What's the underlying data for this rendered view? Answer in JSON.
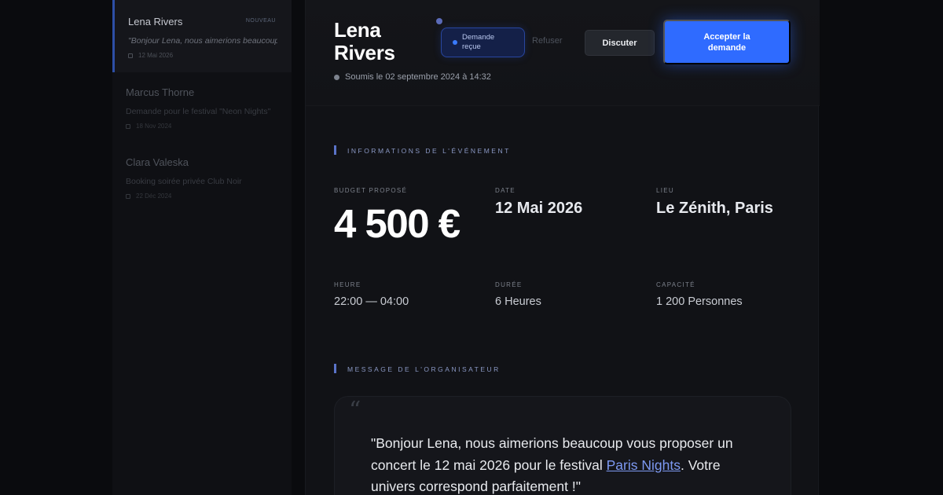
{
  "sidebar": {
    "items": [
      {
        "name": "Lena Rivers",
        "badge": "NOUVEAU",
        "preview": "\"Bonjour Lena, nous aimerions beaucoup vous proposer un concert...",
        "date": "12 Mai 2026"
      },
      {
        "name": "Marcus Thorne",
        "preview": "Demande pour le festival \"Neon Nights\"",
        "date": "18 Nov 2024"
      },
      {
        "name": "Clara Valeska",
        "preview": "Booking soirée privée Club Noir",
        "date": "22 Déc 2024"
      }
    ]
  },
  "header": {
    "artist_name": "Lena Rivers",
    "status_label": "Demande reçue",
    "submitted": "Soumis le 02 septembre 2024 à 14:32",
    "refuse_label": "Refuser",
    "discuss_label": "Discuter",
    "accept_label": "Accepter la demande"
  },
  "event": {
    "section_title": "INFORMATIONS DE L'ÉVÉNEMENT",
    "budget": {
      "label": "BUDGET PROPOSÉ",
      "value": "4 500 €"
    },
    "date": {
      "label": "DATE",
      "value": "12 Mai 2026"
    },
    "lieu": {
      "label": "LIEU",
      "value": "Le Zénith, Paris"
    },
    "heure": {
      "label": "HEURE",
      "value": "22:00 — 04:00"
    },
    "duree": {
      "label": "DURÉE",
      "value": "6 Heures"
    },
    "capacite": {
      "label": "CAPACITÉ",
      "value": "1 200 Personnes"
    }
  },
  "message": {
    "section_title": "MESSAGE DE L'ORGANISATEUR",
    "quote_icon": "“",
    "text_before": "\"Bonjour Lena, nous aimerions beaucoup vous proposer un concert le 12 mai 2026 pour le festival ",
    "link_text": "Paris Nights",
    "text_after": ". Votre univers correspond parfaitement !\""
  },
  "colors": {
    "accent": "#2f6bff",
    "background": "#0a0b0e",
    "panel": "#111216",
    "link": "#7d99f2"
  }
}
